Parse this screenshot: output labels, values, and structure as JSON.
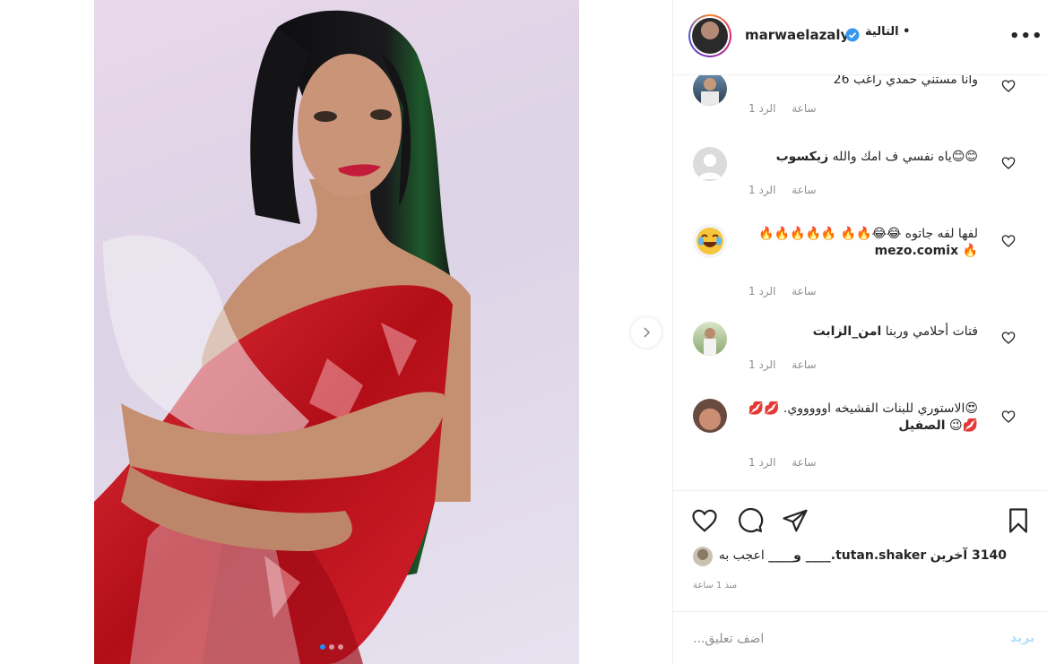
{
  "post": {
    "username": "marwaelazaly",
    "follow_label": "التالية •",
    "more_label": "•••",
    "carousel": {
      "total_slides": 3,
      "current_slide": 1
    }
  },
  "comments": [
    {
      "text_bold": "",
      "text": "وانا مستني حمدي راغب 26",
      "time": "1 ساعة",
      "reply_label": "الرد",
      "avatar": "photo-man"
    },
    {
      "text_bold": "زيكسوب",
      "text": "😊😊ياه نفسي ف امك والله",
      "time": "1 ساعة",
      "reply_label": "الرد",
      "avatar": "default-avatar"
    },
    {
      "text_bold": "mezo.comix",
      "text": "لفها لفه جاتوه 😂😂🔥🔥 🔥🔥🔥🔥🔥🔥",
      "time": "1 ساعة",
      "reply_label": "الرد",
      "avatar": "laughing-emoji"
    },
    {
      "text_bold": "امن_الزابت",
      "text": "فتات أحلامي وربنا",
      "time": "1 ساعة",
      "reply_label": "الرد",
      "avatar": "photo-person-outdoor"
    },
    {
      "text_bold": "الصفيل",
      "text": "😍الاستوري للبنات الفشيخه اوووووي. 💋💋💋😉",
      "time": "1 ساعة",
      "reply_label": "الرد",
      "avatar": "photo-closeup"
    }
  ],
  "likes": {
    "prefix": "اعجب به",
    "names": "tutan.shaker.____ و____",
    "others": "3140 آخرين"
  },
  "timestamp": "منذ 1 ساعة",
  "add_comment": {
    "placeholder": "اضف تعليق...",
    "post_label": "بريد"
  },
  "colors": {
    "verified": "#3897f0",
    "post_disabled": "#b2dffc",
    "dress": "#c8141e"
  }
}
